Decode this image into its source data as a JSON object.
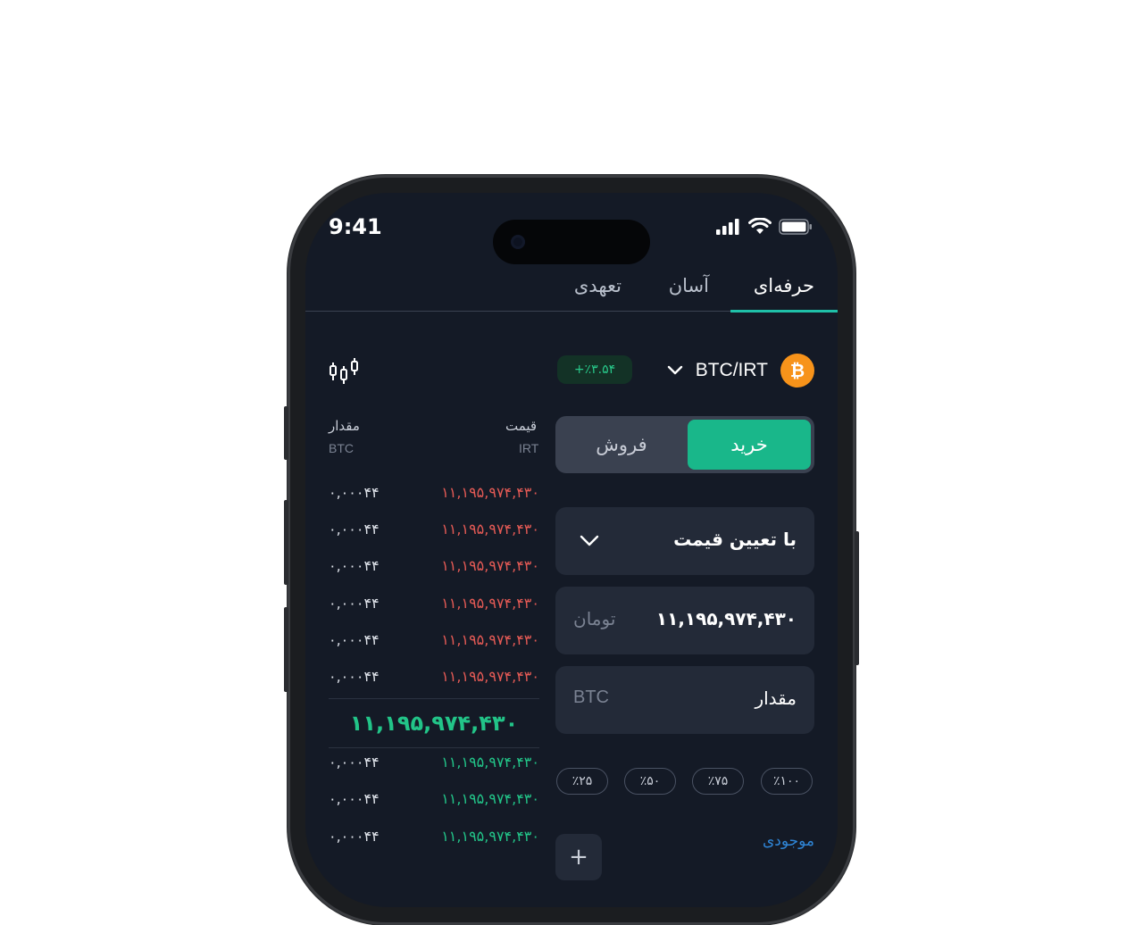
{
  "status": {
    "time": "9:41"
  },
  "tabs": [
    {
      "label": "حرفه‌ای",
      "active": true
    },
    {
      "label": "آسان",
      "active": false
    },
    {
      "label": "تعهدی",
      "active": false
    }
  ],
  "pair": {
    "name": "BTC/IRT",
    "coin_symbol": "₿",
    "change": "+٪۳.۵۴"
  },
  "orderbook": {
    "price_header": "قیمت",
    "price_unit": "IRT",
    "amount_header": "مقدار",
    "amount_unit": "BTC",
    "asks": [
      {
        "price": "۱۱,۱۹۵,۹۷۴,۴۳۰",
        "amount": "۰,۰۰۰۴۴"
      },
      {
        "price": "۱۱,۱۹۵,۹۷۴,۴۳۰",
        "amount": "۰,۰۰۰۴۴"
      },
      {
        "price": "۱۱,۱۹۵,۹۷۴,۴۳۰",
        "amount": "۰,۰۰۰۴۴"
      },
      {
        "price": "۱۱,۱۹۵,۹۷۴,۴۳۰",
        "amount": "۰,۰۰۰۴۴"
      },
      {
        "price": "۱۱,۱۹۵,۹۷۴,۴۳۰",
        "amount": "۰,۰۰۰۴۴"
      },
      {
        "price": "۱۱,۱۹۵,۹۷۴,۴۳۰",
        "amount": "۰,۰۰۰۴۴"
      }
    ],
    "last_price": "۱۱,۱۹۵,۹۷۴,۴۳۰",
    "bids": [
      {
        "price": "۱۱,۱۹۵,۹۷۴,۴۳۰",
        "amount": "۰,۰۰۰۴۴"
      },
      {
        "price": "۱۱,۱۹۵,۹۷۴,۴۳۰",
        "amount": "۰,۰۰۰۴۴"
      },
      {
        "price": "۱۱,۱۹۵,۹۷۴,۴۳۰",
        "amount": "۰,۰۰۰۴۴"
      }
    ]
  },
  "trade": {
    "buy_label": "خرید",
    "sell_label": "فروش",
    "order_type": "با تعیین قیمت",
    "price_value": "۱۱,۱۹۵,۹۷۴,۴۳۰",
    "price_unit": "تومان",
    "amount_label": "مقدار",
    "amount_unit": "BTC",
    "percents": [
      "٪۱۰۰",
      "٪۷۵",
      "٪۵۰",
      "٪۲۵"
    ],
    "balance_label": "موجودی",
    "add_label": "+"
  },
  "colors": {
    "accent": "#1fc0a8",
    "buy": "#19b78a",
    "ask": "#e45a55",
    "bid": "#22c488",
    "bg": "#141a26"
  }
}
